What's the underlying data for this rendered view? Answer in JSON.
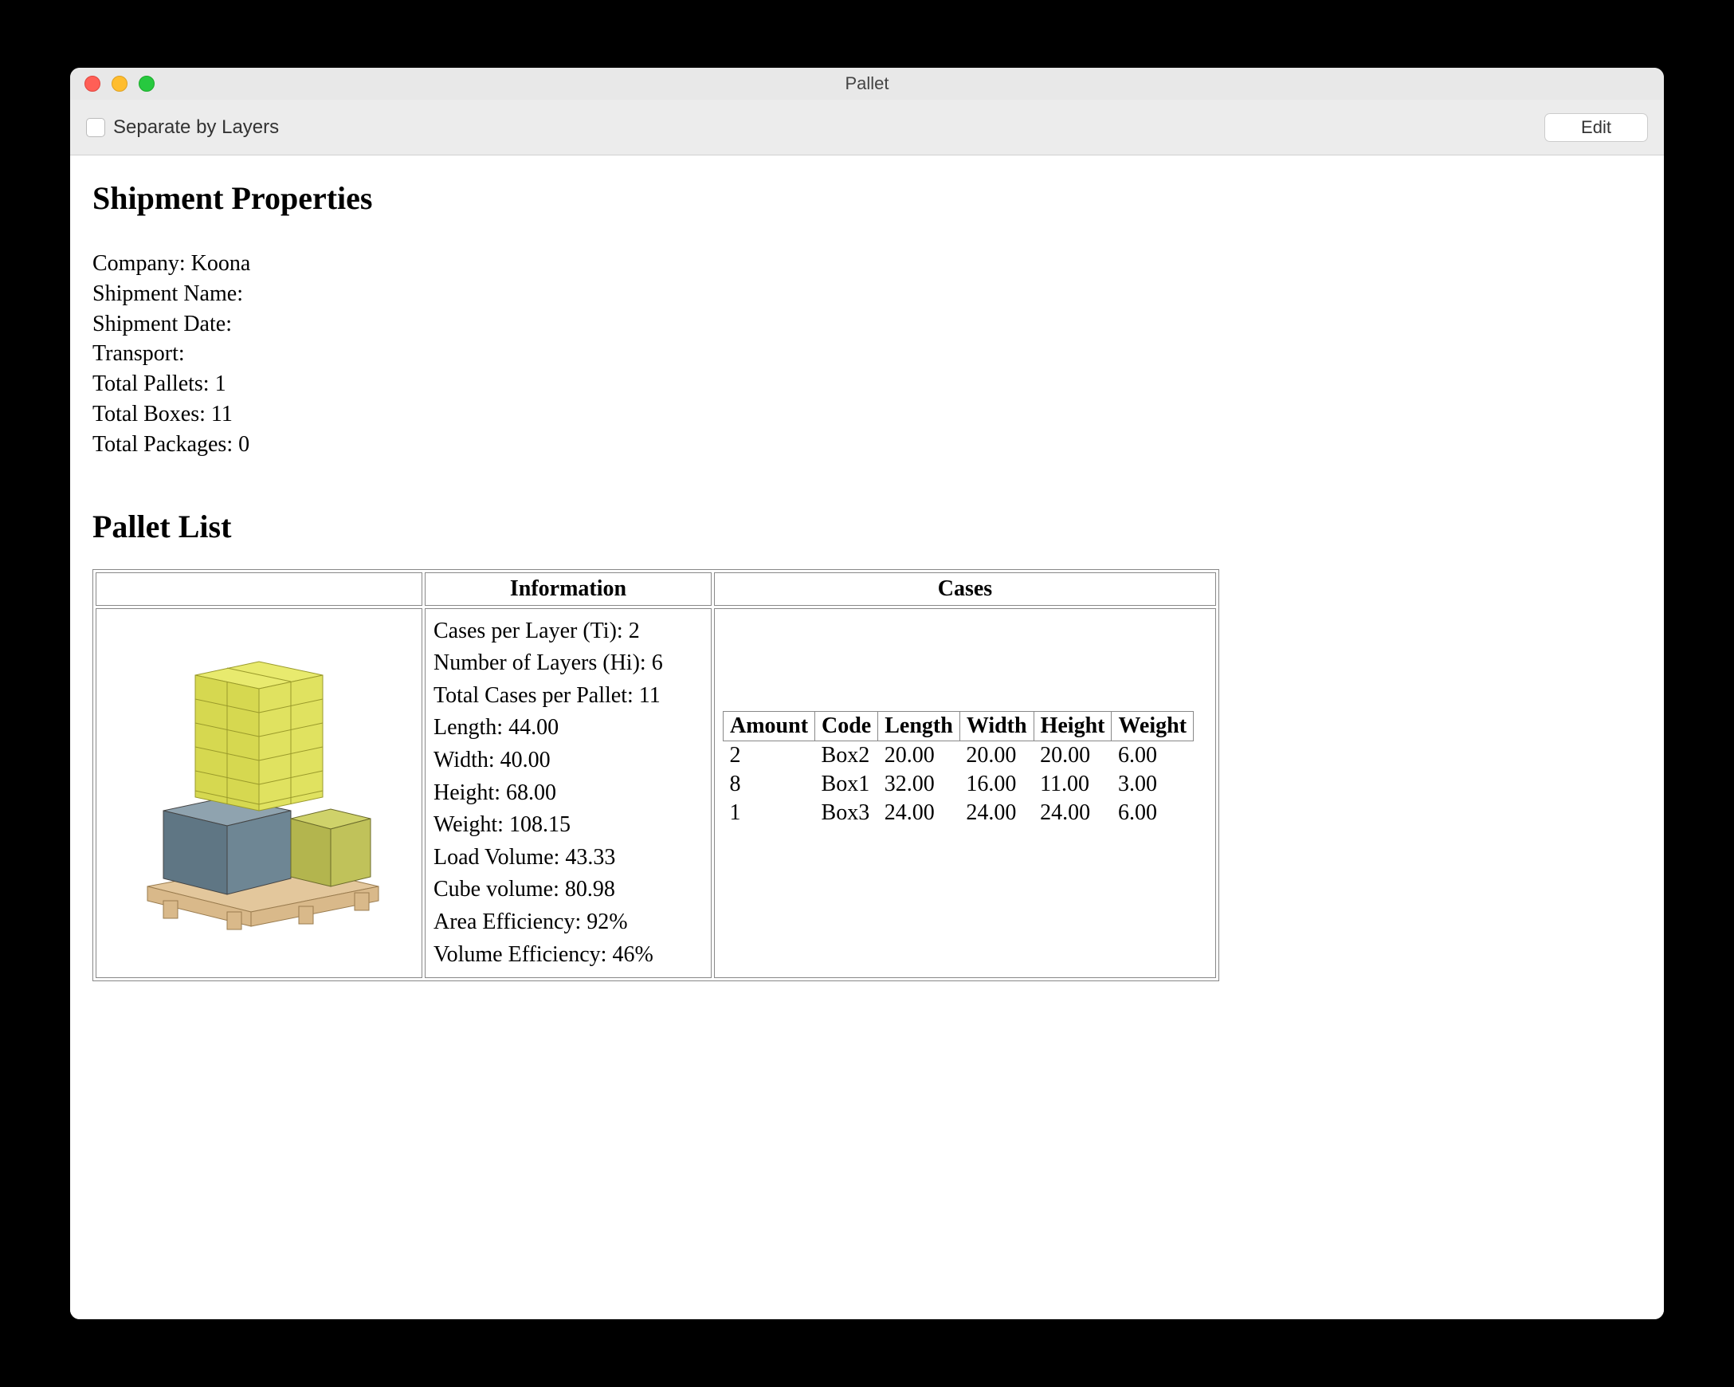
{
  "window": {
    "title": "Pallet"
  },
  "toolbar": {
    "checkbox_label": "Separate by Layers",
    "edit_label": "Edit"
  },
  "headings": {
    "shipment_properties": "Shipment Properties",
    "pallet_list": "Pallet List"
  },
  "properties": {
    "company_label": "Company: ",
    "company_value": "Koona",
    "shipment_name_label": "Shipment Name:",
    "shipment_name_value": "",
    "shipment_date_label": "Shipment Date:",
    "shipment_date_value": "",
    "transport_label": "Transport:",
    "transport_value": "",
    "total_pallets_label": "Total Pallets: ",
    "total_pallets_value": "1",
    "total_boxes_label": "Total Boxes: ",
    "total_boxes_value": "11",
    "total_packages_label": "Total Packages: ",
    "total_packages_value": "0"
  },
  "table_headers": {
    "image": "",
    "information": "Information",
    "cases": "Cases"
  },
  "information": {
    "ti_label": "Cases per Layer (Ti): ",
    "ti_value": "2",
    "hi_label": "Number of Layers (Hi): ",
    "hi_value": "6",
    "total_cases_label": "Total Cases per Pallet: ",
    "total_cases_value": "11",
    "length_label": "Length: ",
    "length_value": "44.00",
    "width_label": "Width: ",
    "width_value": "40.00",
    "height_label": "Height: ",
    "height_value": "68.00",
    "weight_label": "Weight: ",
    "weight_value": "108.15",
    "load_volume_label": "Load Volume: ",
    "load_volume_value": "43.33",
    "cube_volume_label": "Cube volume: ",
    "cube_volume_value": "80.98",
    "area_eff_label": "Area Efficiency: ",
    "area_eff_value": "92%",
    "vol_eff_label": "Volume Efficiency: ",
    "vol_eff_value": "46%"
  },
  "cases_headers": {
    "amount": "Amount",
    "code": "Code",
    "length": "Length",
    "width": "Width",
    "height": "Height",
    "weight": "Weight"
  },
  "cases": [
    {
      "amount": "2",
      "code": "Box2",
      "length": "20.00",
      "width": "20.00",
      "height": "20.00",
      "weight": "6.00"
    },
    {
      "amount": "8",
      "code": "Box1",
      "length": "32.00",
      "width": "16.00",
      "height": "11.00",
      "weight": "3.00"
    },
    {
      "amount": "1",
      "code": "Box3",
      "length": "24.00",
      "width": "24.00",
      "height": "24.00",
      "weight": "6.00"
    }
  ]
}
